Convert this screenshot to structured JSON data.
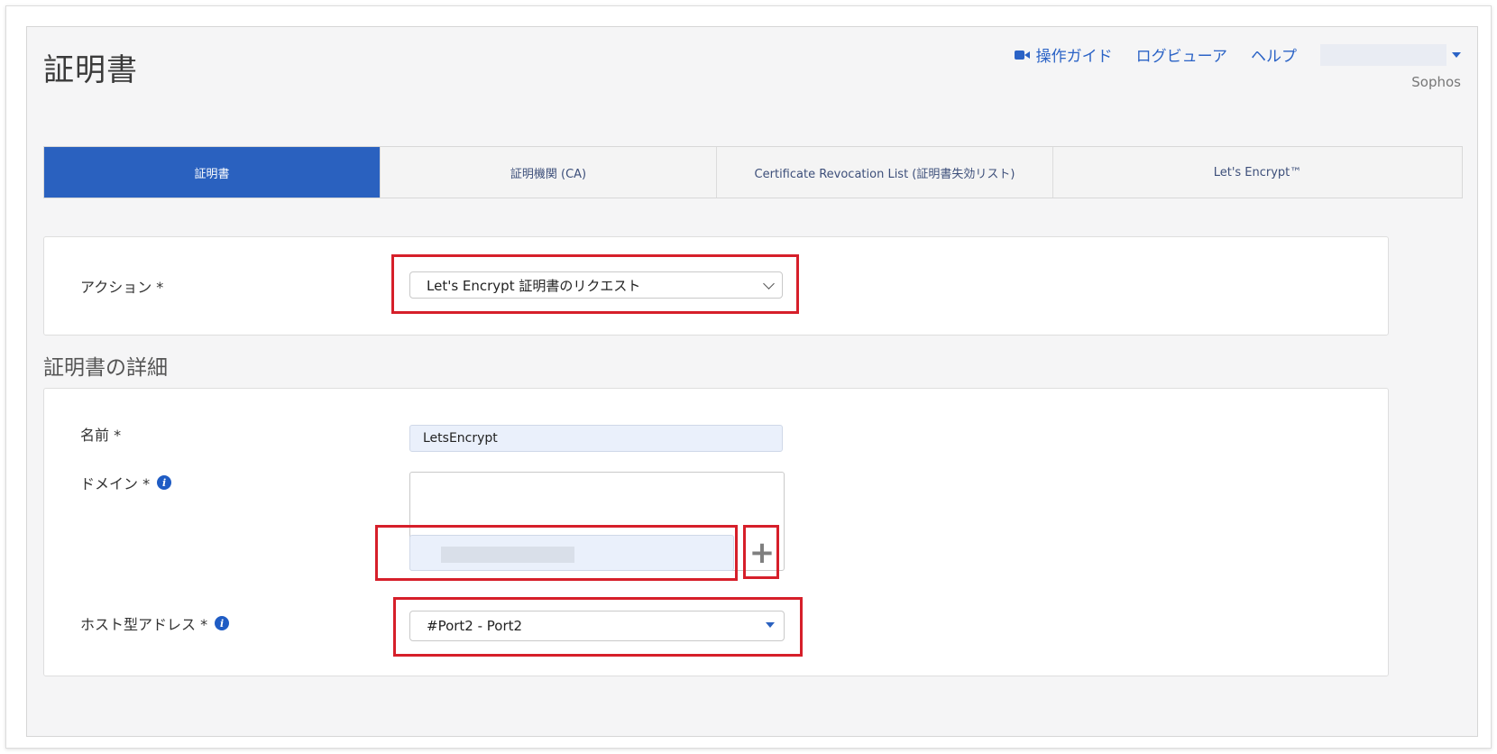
{
  "header": {
    "title": "証明書",
    "links": [
      {
        "label": "操作ガイド",
        "icon": "camera-icon"
      },
      {
        "label": "ログビューア"
      },
      {
        "label": "ヘルプ"
      }
    ],
    "org": "Sophos"
  },
  "tabs": [
    {
      "label": "証明書",
      "active": true
    },
    {
      "label": "証明機関 (CA)"
    },
    {
      "label": "Certificate Revocation List (証明書失効リスト)"
    },
    {
      "label": "Let's Encrypt™"
    }
  ],
  "action": {
    "label": "アクション *",
    "value": "Let's Encrypt 証明書のリクエスト"
  },
  "details": {
    "section_title": "証明書の詳細",
    "name_label": "名前 *",
    "name_value": "LetsEncrypt",
    "domain_label": "ドメイン *",
    "host_label": "ホスト型アドレス *",
    "host_value": "#Port2 - Port2"
  },
  "colors": {
    "accent": "#2a61bf",
    "highlight": "#d61f2a"
  }
}
